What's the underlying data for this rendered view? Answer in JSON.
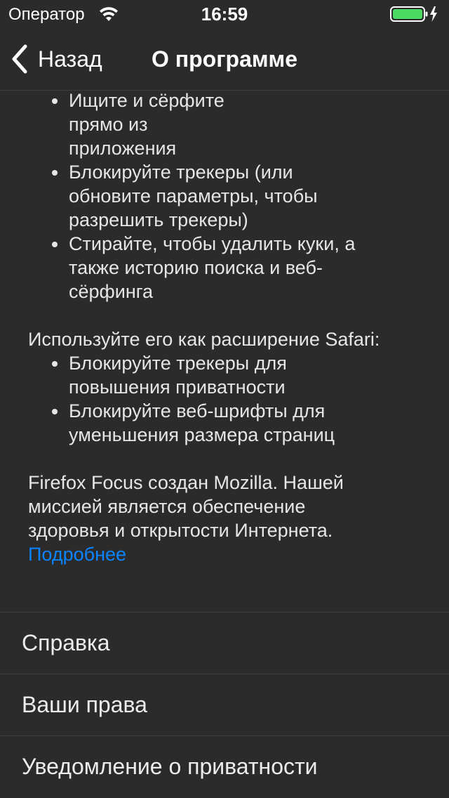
{
  "status_bar": {
    "carrier": "Оператор",
    "time": "16:59",
    "battery_color": "#4cd964"
  },
  "nav": {
    "back_label": "Назад",
    "title": "О программе"
  },
  "about": {
    "bullets_top": [
      "Ищите и сёрфите прямо из приложения",
      "Блокируйте трекеры (или обновите параметры, чтобы разрешить трекеры)",
      "Стирайте, чтобы удалить куки, а также историю поиска и веб-сёрфинга"
    ],
    "extension_heading": "Используйте его как расширение Safari:",
    "bullets_extension": [
      "Блокируйте трекеры для повышения приватности",
      "Блокируйте веб-шрифты для уменьшения размера страниц"
    ],
    "mission": "Firefox Focus создан Mozilla. Нашей миссией является обеспечение здоровья и открытости Интернета.",
    "learn_more": "Подробнее",
    "link_color": "#0a84ff"
  },
  "menu": {
    "items": [
      "Справка",
      "Ваши права",
      "Уведомление о приватности"
    ]
  }
}
